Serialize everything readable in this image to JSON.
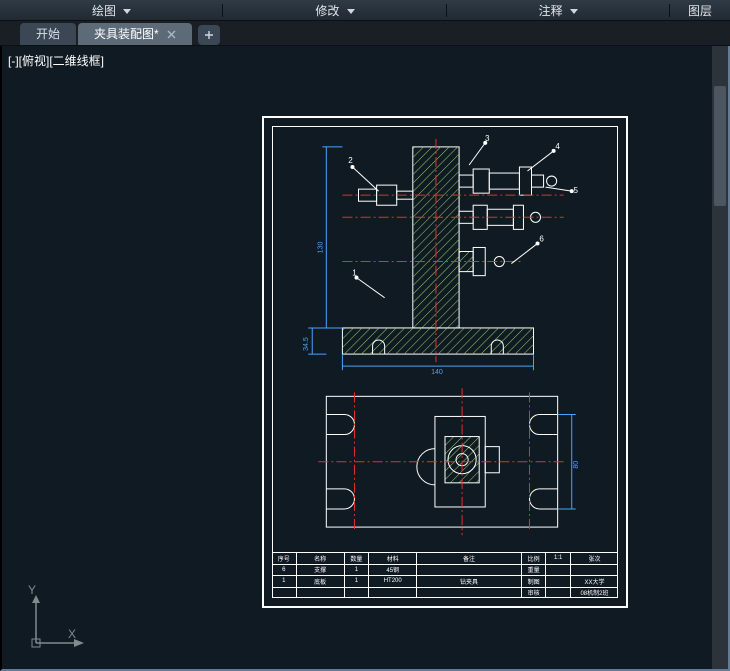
{
  "ribbon": {
    "groups": [
      {
        "label": "绘图"
      },
      {
        "label": "修改"
      },
      {
        "label": "注释"
      },
      {
        "label": "图层"
      }
    ]
  },
  "tabs": {
    "start": "开始",
    "active": "夹具装配图*"
  },
  "viewport": {
    "label": "[-][俯视][二维线框]"
  },
  "ucs": {
    "y": "Y",
    "x": "X"
  },
  "drawing": {
    "callouts": {
      "c1": "1",
      "c2": "2",
      "c3": "3",
      "c4": "4",
      "c5": "5",
      "c6": "6"
    },
    "dims": {
      "d1": "130",
      "d2": "34.5",
      "d3": "140",
      "d4": "80"
    }
  },
  "titleblock": {
    "r1": {
      "a": "序号",
      "b": "名称",
      "c": "数量",
      "d": "材料",
      "e": "备注",
      "f": "比例",
      "g": "1:1",
      "h": "张次"
    },
    "r2": {
      "a": "6",
      "b": "支撑",
      "c": "1",
      "d": "45钢",
      "e": "",
      "f": "重量",
      "g": "",
      "h": ""
    },
    "r3": {
      "a": "1",
      "b": "底板",
      "c": "1",
      "d": "HT200",
      "e": "钻夹具",
      "f": "制图",
      "g": "",
      "h": "XX大学"
    },
    "r4": {
      "a": "",
      "b": "",
      "c": "",
      "d": "",
      "e": "",
      "f": "审核",
      "g": "",
      "h": "08机制2班"
    }
  },
  "colors": {
    "bg": "#0f1a22",
    "stroke": "#ffffff",
    "hatch": "#9ad16a",
    "center": "#e03030",
    "dim": "#4aa3ff"
  }
}
